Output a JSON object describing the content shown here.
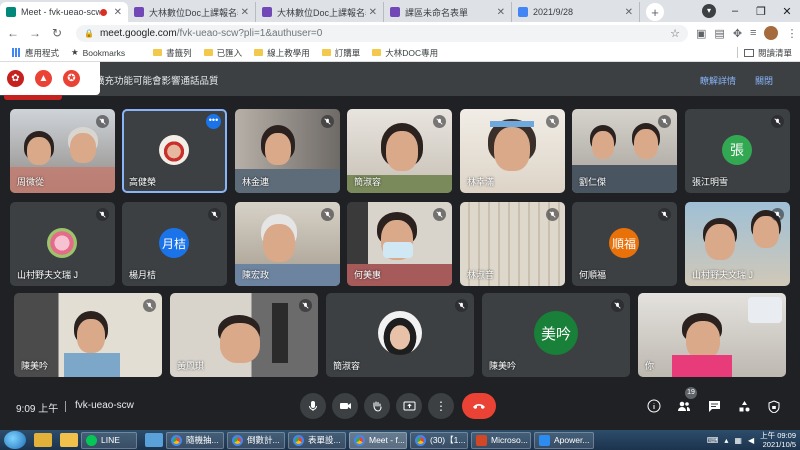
{
  "browser": {
    "tabs": [
      {
        "title": "Meet - fvk-ueao-scw",
        "recording": true,
        "icon": "meet-icon"
      },
      {
        "title": "大林數位Doc上課報名表",
        "icon": "forms-icon"
      },
      {
        "title": "大林數位Doc上課報名表",
        "icon": "forms-icon"
      },
      {
        "title": "課區未命名表單",
        "icon": "forms-icon"
      },
      {
        "title": "2021/9/28",
        "icon": "docs-icon"
      }
    ],
    "address": {
      "domain": "meet.google.com",
      "path": "/fvk-ueao-scw?pli=1&authuser=0"
    },
    "bookmarks": [
      "應用程式",
      "Bookmarks",
      "書籤列",
      "已匯入",
      "線上教學用",
      "訂購單",
      "大林DOC專用"
    ],
    "reading_list": "閱讀清單"
  },
  "notice": {
    "text": "裝的擴充功能可能會影響通話品質",
    "details": "瞭解詳情",
    "close": "關閉"
  },
  "participants": [
    {
      "name": "周微從",
      "muted": true
    },
    {
      "name": "高健榮",
      "muted": false,
      "selected": true
    },
    {
      "name": "林金連",
      "muted": true
    },
    {
      "name": "簡淑容",
      "muted": true
    },
    {
      "name": "林幸滿",
      "muted": true
    },
    {
      "name": "劉仁傑",
      "muted": true
    },
    {
      "name": "張江明雪",
      "muted": true,
      "initial": "張",
      "color": "#33a852"
    },
    {
      "name": "山村野夫文瑞 J",
      "muted": true
    },
    {
      "name": "楊月桔",
      "muted": true,
      "initial": "月桔",
      "color": "#1a73e8"
    },
    {
      "name": "陳宏政",
      "muted": true
    },
    {
      "name": "何美惠",
      "muted": true
    },
    {
      "name": "林淑音",
      "muted": true
    },
    {
      "name": "何順福",
      "muted": true,
      "initial": "順福",
      "color": "#e8710a"
    },
    {
      "name": "山村野夫文瑞 J",
      "muted": true
    },
    {
      "name": "陳美吟",
      "muted": true
    },
    {
      "name": "黃鳳琪",
      "muted": true
    },
    {
      "name": "簡淑容",
      "muted": true
    },
    {
      "name": "陳美吟",
      "muted": true,
      "initial": "美吟",
      "color": "#188038"
    },
    {
      "name": "你",
      "muted": false
    }
  ],
  "controls": {
    "time": "9:09 上午",
    "meeting_code": "fvk-ueao-scw",
    "people_count": "19"
  },
  "taskbar": {
    "items": [
      "LINE",
      "隨機抽...",
      "倒數計...",
      "表單設...",
      "Meet - f...",
      "(30)【1...",
      "Microso...",
      "Apower..."
    ],
    "clock_time": "上午 09:09",
    "clock_date": "2021/10/5"
  }
}
